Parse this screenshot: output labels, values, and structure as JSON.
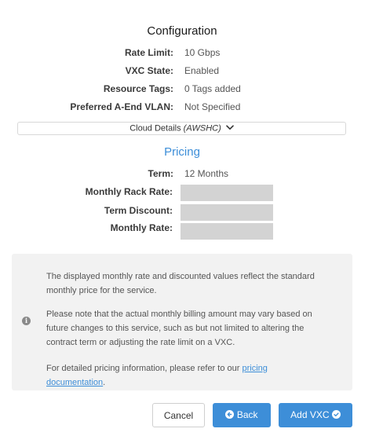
{
  "configuration": {
    "title": "Configuration",
    "rows": [
      {
        "label": "Rate Limit:",
        "value": "10 Gbps"
      },
      {
        "label": "VXC State:",
        "value": "Enabled"
      },
      {
        "label": "Resource Tags:",
        "value": "0 Tags added"
      },
      {
        "label": "Preferred A-End VLAN:",
        "value": "Not Specified"
      }
    ]
  },
  "cloud_details": {
    "label": "Cloud Details",
    "provider": "(AWSHC)",
    "icon": "chevron-down-icon"
  },
  "pricing": {
    "title": "Pricing",
    "term_label": "Term:",
    "term_value": "12 Months",
    "monthly_rack_rate_label": "Monthly Rack Rate:",
    "term_discount_label": "Term Discount:",
    "monthly_rate_label": "Monthly Rate:"
  },
  "info": {
    "icon": "info-icon",
    "p1": "The displayed monthly rate and discounted values reflect the standard monthly price for the service.",
    "p2": "Please note that the actual monthly billing amount may vary based on future changes to this service, such as but not limited to altering the contract term or adjusting the rate limit on a VXC.",
    "p3_prefix": "For detailed pricing information, please refer to our ",
    "p3_link": "pricing documentation",
    "p3_suffix": "."
  },
  "buttons": {
    "cancel": "Cancel",
    "back": "Back",
    "add": "Add VXC"
  },
  "colors": {
    "accent": "#3d8ed8",
    "info_bg": "#f2f2f2",
    "redacted": "#d3d3d3"
  }
}
